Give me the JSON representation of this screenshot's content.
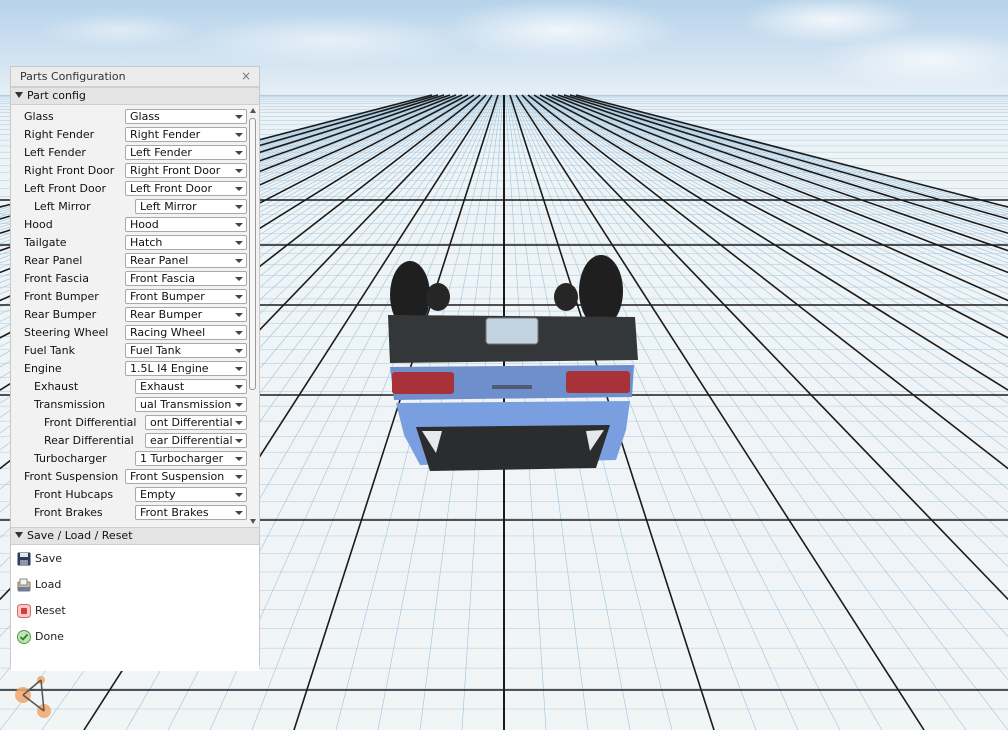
{
  "panel": {
    "title": "Parts Configuration",
    "close_glyph": "×",
    "part_config_header": "Part config",
    "save_header": "Save / Load / Reset"
  },
  "parts": [
    {
      "label": "Glass",
      "value": "Glass",
      "indent": 0
    },
    {
      "label": "Right Fender",
      "value": "Right Fender",
      "indent": 0
    },
    {
      "label": "Left Fender",
      "value": "Left Fender",
      "indent": 0
    },
    {
      "label": "Right Front Door",
      "value": "Right Front Door",
      "indent": 0
    },
    {
      "label": "Left Front Door",
      "value": "Left Front Door",
      "indent": 0
    },
    {
      "label": "Left Mirror",
      "value": "Left Mirror",
      "indent": 1
    },
    {
      "label": "Hood",
      "value": "Hood",
      "indent": 0
    },
    {
      "label": "Tailgate",
      "value": "Hatch",
      "indent": 0
    },
    {
      "label": "Rear Panel",
      "value": "Rear Panel",
      "indent": 0
    },
    {
      "label": "Front Fascia",
      "value": "Front Fascia",
      "indent": 0
    },
    {
      "label": "Front Bumper",
      "value": "Front Bumper",
      "indent": 0
    },
    {
      "label": "Rear Bumper",
      "value": "Rear Bumper",
      "indent": 0
    },
    {
      "label": "Steering Wheel",
      "value": "Racing Wheel",
      "indent": 0
    },
    {
      "label": "Fuel Tank",
      "value": "Fuel Tank",
      "indent": 0
    },
    {
      "label": "Engine",
      "value": "1.5L I4 Engine",
      "indent": 0
    },
    {
      "label": "Exhaust",
      "value": "Exhaust",
      "indent": 1
    },
    {
      "label": "Transmission",
      "value": "ual Transmission",
      "indent": 1
    },
    {
      "label": "Front Differential",
      "value": "ont Differential",
      "indent": 2
    },
    {
      "label": "Rear Differential",
      "value": "ear Differential",
      "indent": 2
    },
    {
      "label": "Turbocharger",
      "value": "1 Turbocharger",
      "indent": 1
    },
    {
      "label": "Front Suspension",
      "value": "Front Suspension",
      "indent": 0
    },
    {
      "label": "Front Hubcaps",
      "value": "Empty",
      "indent": 1
    },
    {
      "label": "Front Brakes",
      "value": "Front Brakes",
      "indent": 1
    }
  ],
  "actions": [
    {
      "label": "Save",
      "icon": "floppy-disk-icon"
    },
    {
      "label": "Load",
      "icon": "folder-load-icon"
    },
    {
      "label": "Reset",
      "icon": "reset-icon"
    },
    {
      "label": "Done",
      "icon": "done-icon"
    }
  ],
  "colors": {
    "car_body": "#7a9fe0",
    "car_dark": "#2e3235",
    "taillight": "#a8323a",
    "grid_line": "#1b1b1b",
    "logo_orange": "#f2a46a"
  }
}
